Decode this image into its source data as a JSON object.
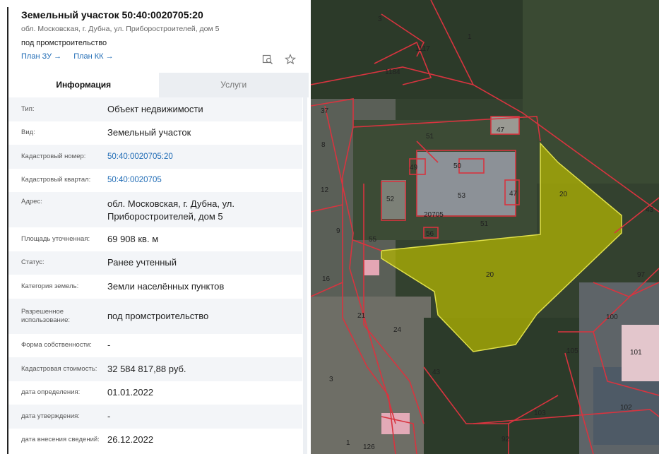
{
  "header": {
    "title": "Земельный участок 50:40:0020705:20",
    "address": "обл. Московская, г. Дубна, ул. Приборостроителей, дом 5",
    "purpose": "под промстроительство",
    "link_plan_zu": "План ЗУ →",
    "link_plan_kk": "План КК →",
    "search_icon": "map-search-icon",
    "star_icon": "star-icon"
  },
  "tabs": {
    "info": "Информация",
    "services": "Услуги"
  },
  "rows": [
    {
      "label": "Тип:",
      "value": "Объект недвижимости"
    },
    {
      "label": "Вид:",
      "value": "Земельный участок"
    },
    {
      "label": "Кадастровый номер:",
      "value": "50:40:0020705:20"
    },
    {
      "label": "Кадастровый квартал:",
      "value": "50:40:0020705"
    },
    {
      "label": "Адрес:",
      "value": "обл. Московская, г. Дубна, ул. Приборостроителей, дом 5"
    },
    {
      "label": "Площадь уточненная:",
      "value": "69 908 кв. м"
    },
    {
      "label": "Статус:",
      "value": "Ранее учтенный"
    },
    {
      "label": "Категория земель:",
      "value": "Земли населённых пунктов"
    },
    {
      "label": "Разрешенное использование:",
      "value": "под промстроительство"
    },
    {
      "label": "Форма собственности:",
      "value": "-"
    },
    {
      "label": "Кадастровая стоимость:",
      "value": "32 584 817,88 руб."
    },
    {
      "label": "дата определения:",
      "value": "01.01.2022"
    },
    {
      "label": "дата утверждения:",
      "value": "-"
    },
    {
      "label": "дата внесения сведений:",
      "value": "26.12.2022"
    }
  ],
  "map": {
    "parcel_labels": [
      "20",
      "20",
      "1",
      "3",
      "1117",
      "1184",
      "37",
      "8",
      "12",
      "9",
      "16",
      "21",
      "24",
      "47",
      "51",
      "50",
      "49",
      "52",
      "53",
      "47",
      "20705",
      "51",
      "55",
      "56",
      "43",
      "97",
      "100",
      "105",
      "101",
      "43",
      "3",
      "102",
      "103",
      "126",
      "92",
      "1"
    ],
    "highlight_color": "#b5b800",
    "boundary_color": "#d8343f"
  }
}
